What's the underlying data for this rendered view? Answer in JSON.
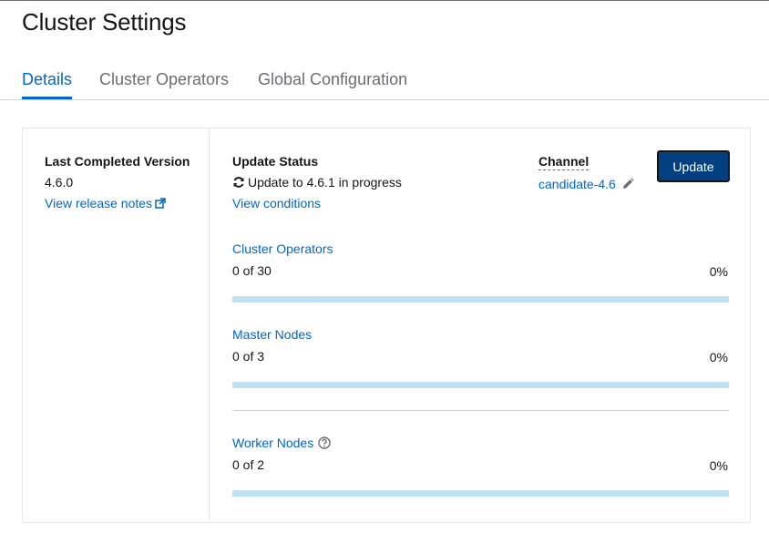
{
  "page": {
    "title": "Cluster Settings"
  },
  "tabs": [
    {
      "label": "Details",
      "active": true
    },
    {
      "label": "Cluster Operators",
      "active": false
    },
    {
      "label": "Global Configuration",
      "active": false
    }
  ],
  "version": {
    "label": "Last Completed Version",
    "value": "4.6.0",
    "release_notes_link": "View release notes"
  },
  "update_status": {
    "label": "Update Status",
    "value": "Update to 4.6.1 in progress",
    "conditions_link": "View conditions",
    "icon": "sync-icon"
  },
  "channel": {
    "label": "Channel",
    "value": "candidate-4.6",
    "edit_icon": "pencil-icon"
  },
  "update_button": {
    "label": "Update"
  },
  "progress": {
    "cluster_operators": {
      "label": "Cluster Operators",
      "count": "0 of 30",
      "percent_text": "0%",
      "fraction": 0
    },
    "master_nodes": {
      "label": "Master Nodes",
      "count": "0 of 3",
      "percent_text": "0%",
      "fraction": 0
    },
    "worker_nodes": {
      "label": "Worker Nodes",
      "count": "0 of 2",
      "percent_text": "0%",
      "fraction": 0,
      "help_icon": "question-circle-icon"
    }
  },
  "colors": {
    "link": "#0066cc",
    "primary_button": "#004080",
    "bar_track": "#bee1f4",
    "bar_fill": "#0066cc"
  }
}
